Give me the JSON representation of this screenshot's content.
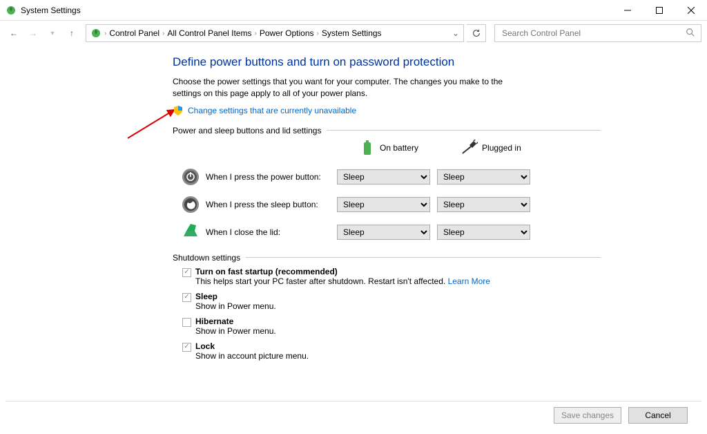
{
  "window": {
    "title": "System Settings"
  },
  "breadcrumbs": {
    "items": [
      "Control Panel",
      "All Control Panel Items",
      "Power Options",
      "System Settings"
    ]
  },
  "search": {
    "placeholder": "Search Control Panel"
  },
  "page": {
    "heading": "Define power buttons and turn on password protection",
    "description": "Choose the power settings that you want for your computer. The changes you make to the settings on this page apply to all of your power plans.",
    "change_link": "Change settings that are currently unavailable"
  },
  "section_buttons": {
    "legend": "Power and sleep buttons and lid settings",
    "cols": {
      "battery": "On battery",
      "plugged": "Plugged in"
    },
    "rows": [
      {
        "label": "When I press the power button:",
        "battery": "Sleep",
        "plugged": "Sleep"
      },
      {
        "label": "When I press the sleep button:",
        "battery": "Sleep",
        "plugged": "Sleep"
      },
      {
        "label": "When I close the lid:",
        "battery": "Sleep",
        "plugged": "Sleep"
      }
    ]
  },
  "section_shutdown": {
    "legend": "Shutdown settings",
    "items": [
      {
        "title": "Turn on fast startup (recommended)",
        "sub": "This helps start your PC faster after shutdown. Restart isn't affected. ",
        "learn": "Learn More",
        "checked": true
      },
      {
        "title": "Sleep",
        "sub": "Show in Power menu.",
        "checked": true
      },
      {
        "title": "Hibernate",
        "sub": "Show in Power menu.",
        "checked": false
      },
      {
        "title": "Lock",
        "sub": "Show in account picture menu.",
        "checked": true
      }
    ]
  },
  "footer": {
    "save": "Save changes",
    "cancel": "Cancel"
  }
}
